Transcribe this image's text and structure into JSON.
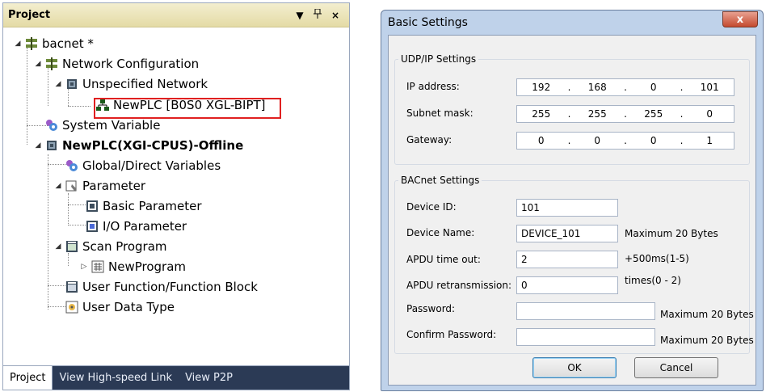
{
  "project": {
    "header": {
      "title": "Project",
      "dropdown_glyph": "▼",
      "pin_glyph": "ᵖ",
      "close_glyph": "×"
    },
    "tree": {
      "root": "bacnet *",
      "network_config": "Network Configuration",
      "unspecified_network": "Unspecified Network",
      "newplc_node": "NewPLC [B0S0 XGL-BIPT]",
      "system_variable": "System Variable",
      "plc": "NewPLC(XGI-CPUS)-Offline",
      "global_vars": "Global/Direct Variables",
      "parameter": "Parameter",
      "basic_parameter": "Basic Parameter",
      "io_parameter": "I/O Parameter",
      "scan_program": "Scan Program",
      "new_program": "NewProgram",
      "user_function": "User Function/Function Block",
      "user_data_type": "User Data Type"
    },
    "tabs": [
      "Project",
      "View High-speed Link",
      "View P2P"
    ]
  },
  "dialog": {
    "title": "Basic Settings",
    "close_glyph": "x",
    "udp": {
      "legend": "UDP/IP Settings",
      "ip_label": "IP address:",
      "ip": [
        "192",
        "168",
        "0",
        "101"
      ],
      "subnet_label": "Subnet mask:",
      "subnet": [
        "255",
        "255",
        "255",
        "0"
      ],
      "gateway_label": "Gateway:",
      "gateway": [
        "0",
        "0",
        "0",
        "1"
      ]
    },
    "bacnet": {
      "legend": "BACnet Settings",
      "device_id_label": "Device ID:",
      "device_id": "101",
      "device_name_label": "Device Name:",
      "device_name": "DEVICE_101",
      "device_name_hint": "Maximum 20 Bytes",
      "apdu_timeout_label": "APDU time out:",
      "apdu_timeout": "2",
      "apdu_timeout_hint": "+500ms(1-5)",
      "apdu_retrans_label": "APDU retransmission:",
      "apdu_retrans": "0",
      "apdu_retrans_hint": "times(0 - 2)",
      "password_label": "Password:",
      "password": "",
      "password_hint": "Maximum 20 Bytes",
      "confirm_label": "Confirm Password:",
      "confirm": "",
      "confirm_hint": "Maximum 20 Bytes"
    },
    "ok_label": "OK",
    "cancel_label": "Cancel"
  },
  "colors": {
    "highlight": "#e02020",
    "dialog_frame": "#bfd2ea",
    "tab_bar": "#2b3a55"
  }
}
